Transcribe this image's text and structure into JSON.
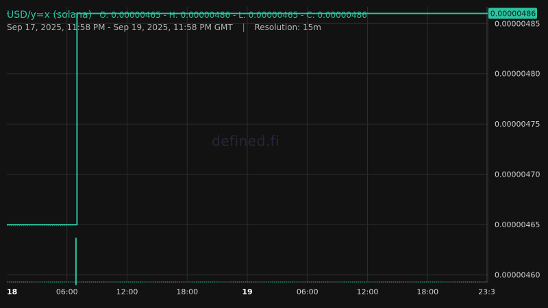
{
  "header": {
    "pair": "USD/y=x (solana)",
    "ohlc": "O: 0.00000465 - H: 0.00000486 - L: 0.00000465 - C: 0.00000486",
    "range": "Sep 17, 2025, 11:58 PM - Sep 19, 2025, 11:58 PM GMT",
    "separator": "|",
    "resolution": "Resolution: 15m"
  },
  "watermark": "defined.fi",
  "colors": {
    "background": "#121212",
    "grid": "#2c2c2c",
    "accent": "#2bc3a0",
    "text": "#d0d0d0"
  },
  "chart_data": {
    "type": "line",
    "y_ticks": [
      4.6e-06,
      4.65e-06,
      4.7e-06,
      4.75e-06,
      4.8e-06,
      4.85e-06
    ],
    "y_tick_labels": [
      "0.00000460",
      "0.00000465",
      "0.00000470",
      "0.00000475",
      "0.00000480",
      "0.00000485"
    ],
    "ylim": [
      4.593e-06,
      4.8665e-06
    ],
    "x_tick_labels": [
      "18",
      "06:00",
      "12:00",
      "18:00",
      "19",
      "06:00",
      "12:00",
      "18:00",
      "23:3"
    ],
    "x_tick_bold": [
      true,
      false,
      false,
      false,
      true,
      false,
      false,
      false,
      false
    ],
    "x_tick_hours": [
      24,
      30,
      36,
      42,
      48,
      54,
      60,
      66,
      71.9
    ],
    "xlim": [
      24,
      72
    ],
    "series": [
      {
        "points": [
          [
            24,
            4.65e-06
          ],
          [
            31,
            4.65e-06
          ],
          [
            31,
            4.86e-06
          ],
          [
            72,
            4.86e-06
          ]
        ]
      }
    ],
    "low_bar": {
      "x": 30.9,
      "top": 4.637e-06,
      "bottom": 4.59e-06
    },
    "last_price": 4.86e-06,
    "last_price_label": "0.00000486",
    "baseline_value": 4.593e-06
  }
}
